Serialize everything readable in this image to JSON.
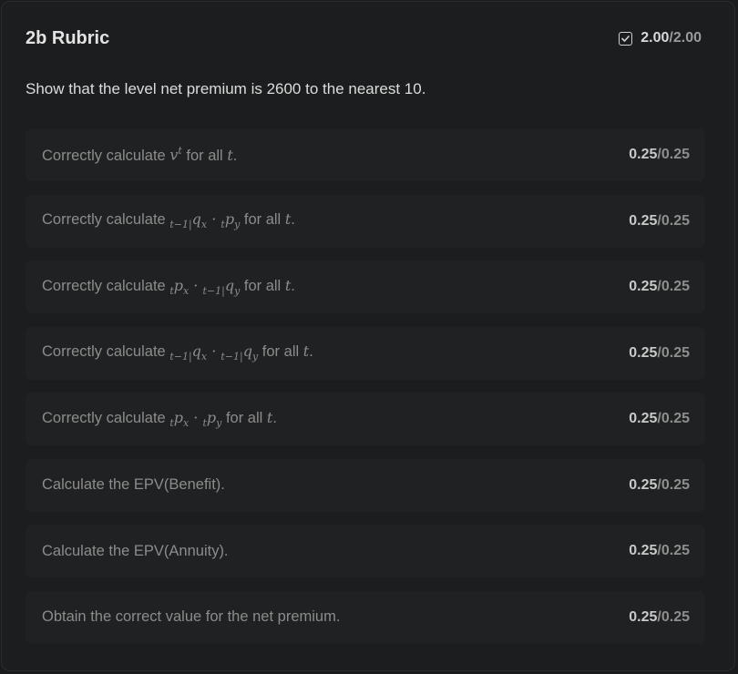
{
  "header": {
    "title": "2b Rubric",
    "score_earned": "2.00",
    "score_total": "/2.00",
    "icon": "checkbox-checked-icon"
  },
  "prompt": "Show that the level net premium is 2600 to the nearest 10.",
  "criteria": [
    {
      "text": "Correctly calculate",
      "suffix": "for all",
      "var": "t",
      "earned": "0.25",
      "total": "/0.25"
    },
    {
      "text": "Correctly calculate",
      "suffix": "for all",
      "var": "t",
      "earned": "0.25",
      "total": "/0.25"
    },
    {
      "text": "Correctly calculate",
      "suffix": "for all",
      "var": "t",
      "earned": "0.25",
      "total": "/0.25"
    },
    {
      "text": "Correctly calculate",
      "suffix": "for all",
      "var": "t",
      "earned": "0.25",
      "total": "/0.25"
    },
    {
      "text": "Correctly calculate",
      "suffix": "for all",
      "var": "t",
      "earned": "0.25",
      "total": "/0.25"
    },
    {
      "text": "Calculate the EPV(Benefit).",
      "earned": "0.25",
      "total": "/0.25"
    },
    {
      "text": "Calculate the EPV(Annuity).",
      "earned": "0.25",
      "total": "/0.25"
    },
    {
      "text": "Obtain the correct value for the net premium.",
      "earned": "0.25",
      "total": "/0.25"
    }
  ]
}
